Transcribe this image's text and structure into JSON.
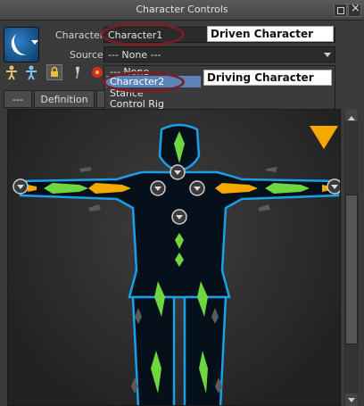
{
  "window": {
    "title": "Character Controls"
  },
  "character": {
    "label": "Character",
    "value": "Character1"
  },
  "source": {
    "label": "Source:",
    "value": "--- None ---"
  },
  "annotations": {
    "driven": "Driven Character",
    "driving": "Driving Character"
  },
  "dropdown": {
    "items": [
      "--- None",
      "Character2",
      "Stance",
      "Control Rig"
    ],
    "selected": "Character2"
  },
  "tabs": [
    "---",
    "Definition"
  ],
  "colors": {
    "bone_green": "#6fd640",
    "bone_orange": "#f5a800",
    "body_blue": "#1aa0e8",
    "selection": "#5b83b8"
  }
}
